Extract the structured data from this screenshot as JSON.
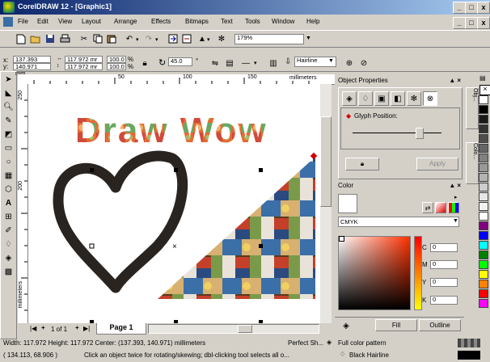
{
  "window": {
    "title": "CorelDRAW 12 - [Graphic1]",
    "min": "_",
    "max": "□",
    "close": "x",
    "doc_min": "_",
    "doc_max": "□",
    "doc_close": "x"
  },
  "menu": [
    "File",
    "Edit",
    "View",
    "Layout",
    "Arrange",
    "Effects",
    "Bitmaps",
    "Text",
    "Tools",
    "Window",
    "Help"
  ],
  "toolbar": {
    "zoom": "179%"
  },
  "propbar": {
    "x_label": "x:",
    "x_value": "137.393 mm",
    "y_label": "y:",
    "y_value": "140.971 mm",
    "w_value": "117.972 mr",
    "h_value": "117.972 mr",
    "scale_x": "100.0",
    "scale_y": "100.0",
    "pct": "%",
    "angle": "45.0",
    "deg": "°",
    "outline": "Hairline"
  },
  "ruler": {
    "unit": "millimeters",
    "ticks_h": [
      "50",
      "100",
      "150"
    ],
    "ticks_v": [
      "250",
      "200"
    ],
    "v_unit": "millimeters"
  },
  "canvas": {
    "text": "Draw Wow",
    "selection_marks": "•"
  },
  "page_nav": {
    "first": "|◀",
    "prev": "+",
    "page_of": "1 of 1",
    "add": "+",
    "last": "▶|",
    "page_tab": "Page 1"
  },
  "docker": {
    "object_properties": {
      "title": "Object Properties",
      "side_tab": "Obj...",
      "glyph_position": "Glyph Position:",
      "apply": "Apply"
    },
    "color": {
      "title": "Color",
      "model": "CMYK",
      "c_label": "C",
      "c_value": "0",
      "m_label": "M",
      "m_value": "0",
      "y_label": "Y",
      "y_value": "0",
      "k_label": "K",
      "k_value": "0",
      "fill": "Fill",
      "outline": "Outline",
      "side_tab": "Colo..."
    }
  },
  "palette_colors": [
    "#ffffff",
    "#000000",
    "#1a1a1a",
    "#333333",
    "#4d4d4d",
    "#666666",
    "#808080",
    "#999999",
    "#b3b3b3",
    "#cccccc",
    "#e6e6e6",
    "#f2f2f2",
    "#ffffff",
    "#800080",
    "#0000ff",
    "#00ffff",
    "#008000",
    "#00ff00",
    "#ffff00",
    "#ff8000",
    "#ff0000",
    "#ff00ff"
  ],
  "status": {
    "line1": "Width: 117.972  Height: 117.972  Center: (137.393, 140.971)  millimeters",
    "selection": "Perfect Sh...",
    "fill_label": "Full color pattern",
    "coords": "( 134.113, 68.906 )",
    "hint": "Click an object twice for rotating/skewing; dbl-clicking tool selects all o...",
    "outline_label": "Black  Hairline"
  },
  "colors": {
    "titlebar_start": "#0a246a",
    "titlebar_end": "#a6caf0",
    "heart_stroke": "#2a2420",
    "selected_outline": "#d40000"
  }
}
